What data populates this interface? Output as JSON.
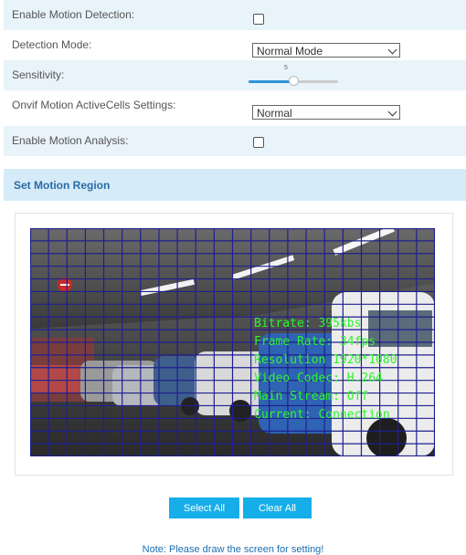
{
  "settings": {
    "enable_motion_detection": {
      "label": "Enable Motion Detection:",
      "checked": false
    },
    "detection_mode": {
      "label": "Detection Mode:",
      "value": "Normal Mode"
    },
    "sensitivity": {
      "label": "Sensitivity:",
      "value": "5",
      "max": 10
    },
    "onvif_cells": {
      "label": "Onvif Motion ActiveCells Settings:",
      "value": "Normal"
    },
    "enable_motion_analysis": {
      "label": "Enable Motion Analysis:",
      "checked": false
    }
  },
  "region": {
    "title": "Set Motion Region",
    "grid": {
      "columns": 22,
      "rows": 18,
      "color": "#1f1f8f"
    },
    "osd_lines": [
      "Bitrate: 395kbs",
      "Frame Rate: 34fps",
      "Resolution 1920*1080",
      "Video Codec: H.264",
      "Main Stream: Off",
      "Current: Connection"
    ]
  },
  "buttons": {
    "select_all": "Select All",
    "clear_all": "Clear All"
  },
  "note": "Note: Please draw the screen for setting!",
  "colors": {
    "accent": "#15aee8",
    "section_bg": "#d5ebf8",
    "row_alt": "#e8f3fa",
    "osd": "#2df52d"
  }
}
